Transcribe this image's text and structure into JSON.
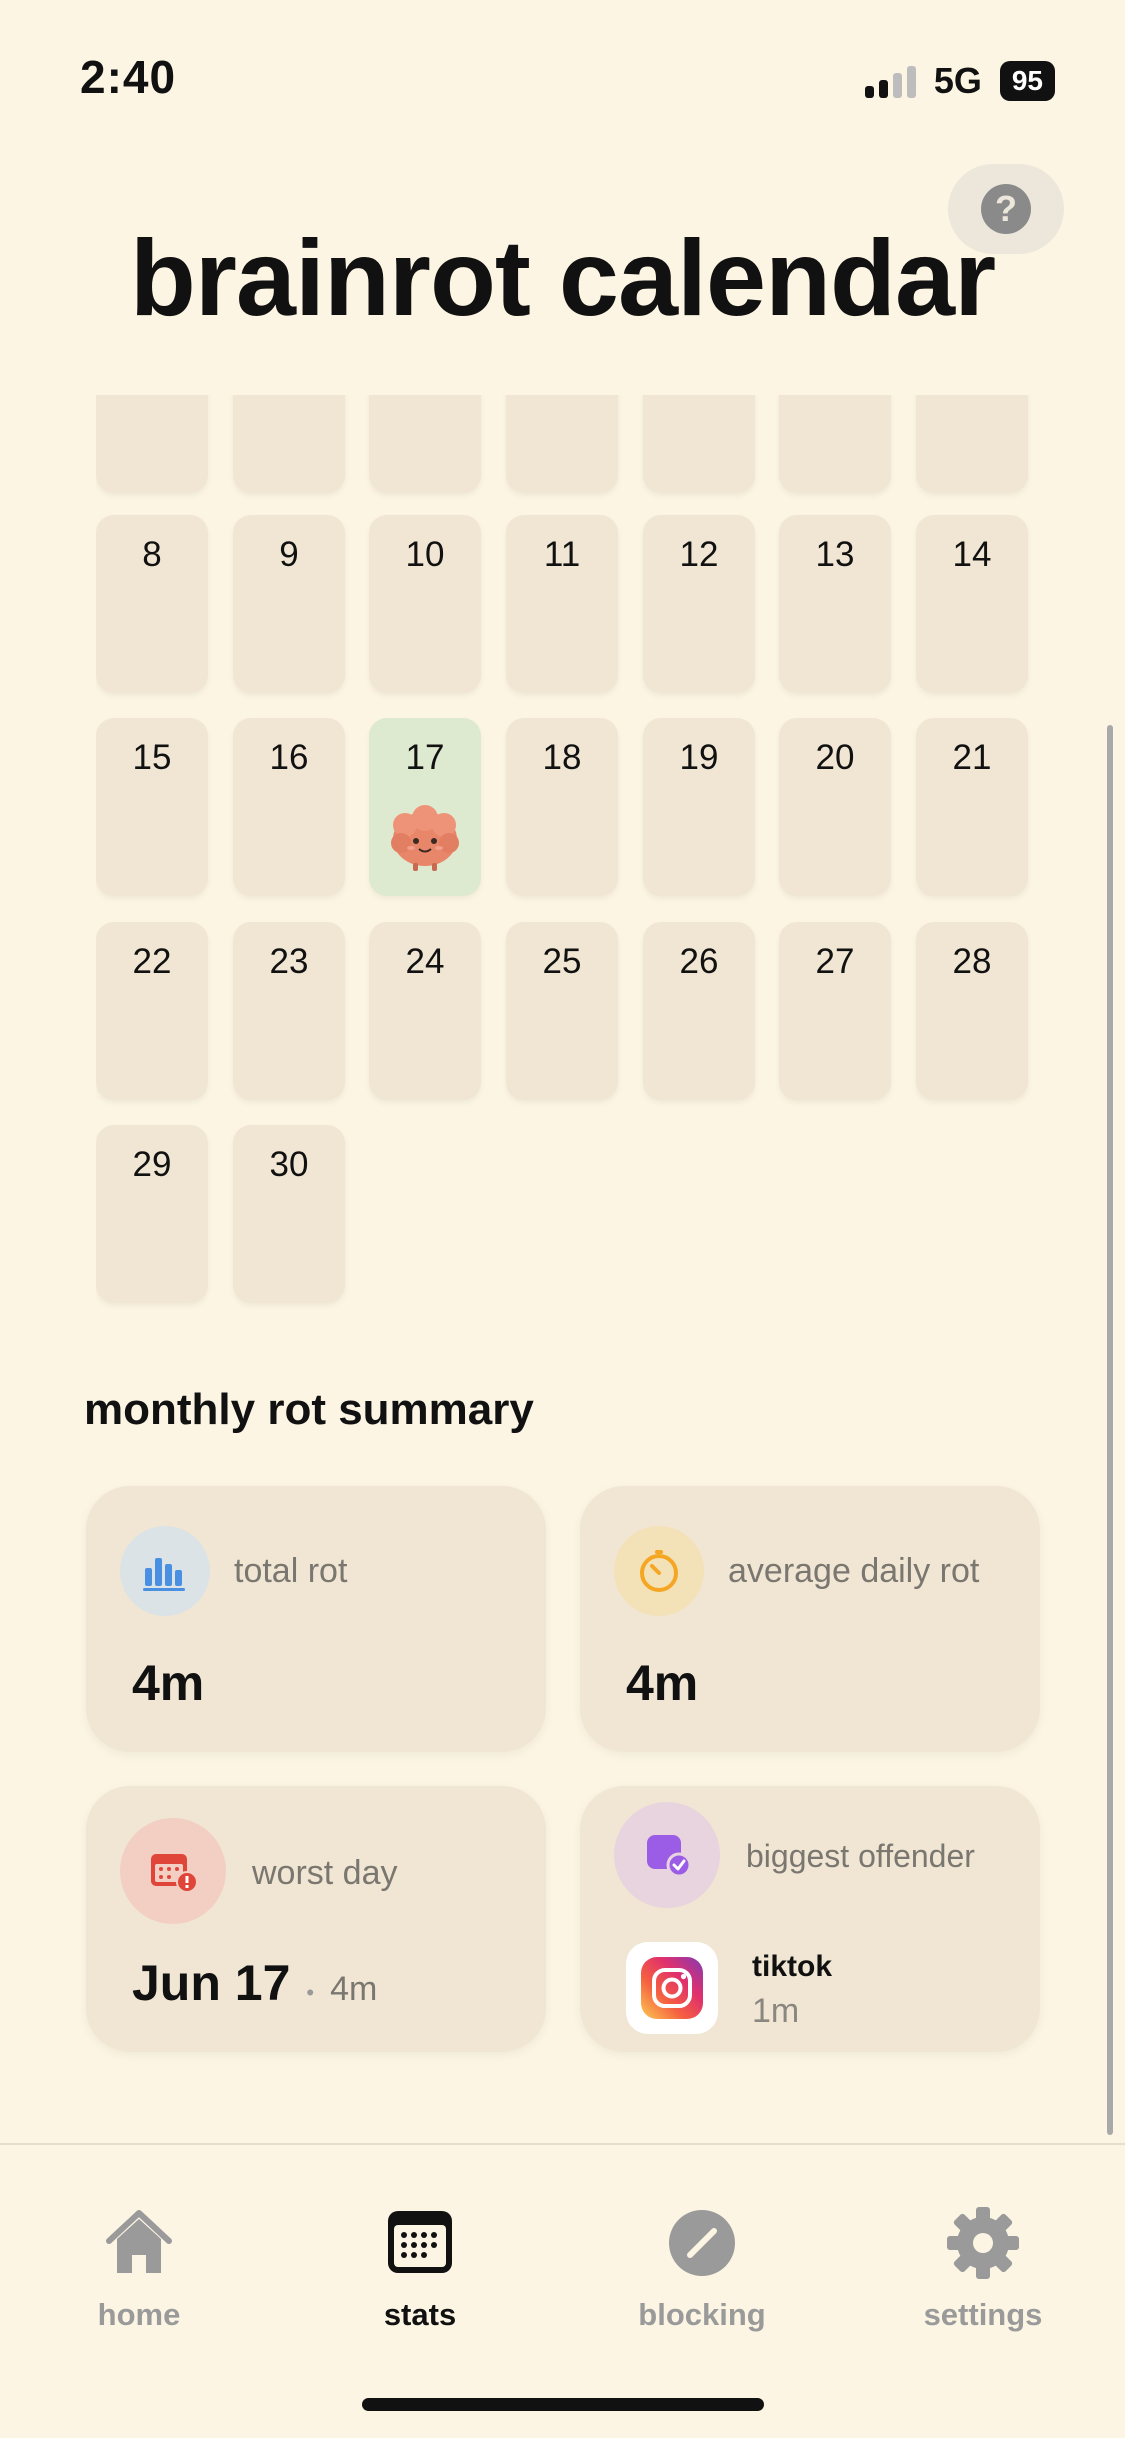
{
  "status_bar": {
    "time": "2:40",
    "network": "5G",
    "battery": "95"
  },
  "header": {
    "title": "brainrot calendar",
    "help_label": "?"
  },
  "calendar": {
    "partial_row_count": 7,
    "days": [
      "8",
      "9",
      "10",
      "11",
      "12",
      "13",
      "14",
      "15",
      "16",
      "17",
      "18",
      "19",
      "20",
      "21",
      "22",
      "23",
      "24",
      "25",
      "26",
      "27",
      "28",
      "29",
      "30"
    ],
    "active_day": "17"
  },
  "summary": {
    "title": "monthly rot summary",
    "total_rot": {
      "label": "total rot",
      "value": "4m"
    },
    "average_daily_rot": {
      "label": "average daily rot",
      "value": "4m"
    },
    "worst_day": {
      "label": "worst day",
      "date": "Jun 17",
      "separator": "•",
      "value": "4m"
    },
    "biggest_offender": {
      "label": "biggest offender",
      "app_name": "tiktok",
      "app_value": "1m",
      "app_icon": "instagram-icon"
    }
  },
  "tabbar": {
    "tabs": [
      {
        "label": "home",
        "icon": "house-icon"
      },
      {
        "label": "stats",
        "icon": "calendar-icon"
      },
      {
        "label": "blocking",
        "icon": "block-icon"
      },
      {
        "label": "settings",
        "icon": "gear-icon"
      }
    ],
    "selected": "stats"
  },
  "colors": {
    "background": "#FCF5E3",
    "cell": "#F0E6D3",
    "active_cell": "#DDEACF",
    "total_rot_icon": "#4A90E2",
    "average_icon": "#F5A623",
    "worst_day_icon": "#E0453A",
    "offender_icon": "#9B5DE5"
  }
}
